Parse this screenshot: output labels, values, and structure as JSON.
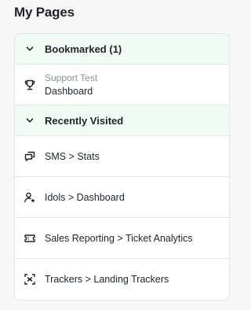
{
  "page": {
    "title": "My Pages"
  },
  "bookmarked": {
    "label": "Bookmarked (1)",
    "icon": "chevron-down-icon",
    "items": [
      {
        "subtitle": "Support Test",
        "title": "Dashboard",
        "icon": "trophy-icon"
      }
    ]
  },
  "recent": {
    "label": "Recently Visited",
    "icon": "chevron-down-icon",
    "items": [
      {
        "label": "SMS > Stats",
        "icon": "chat-bubbles-icon"
      },
      {
        "label": "Idols > Dashboard",
        "icon": "user-star-icon"
      },
      {
        "label": "Sales Reporting > Ticket Analytics",
        "icon": "ticket-icon"
      },
      {
        "label": "Trackers > Landing Trackers",
        "icon": "target-icon"
      }
    ]
  },
  "colors": {
    "section_bg": "#f1fbf5",
    "border": "#e3e5e8",
    "muted_text": "#8a8f96"
  }
}
